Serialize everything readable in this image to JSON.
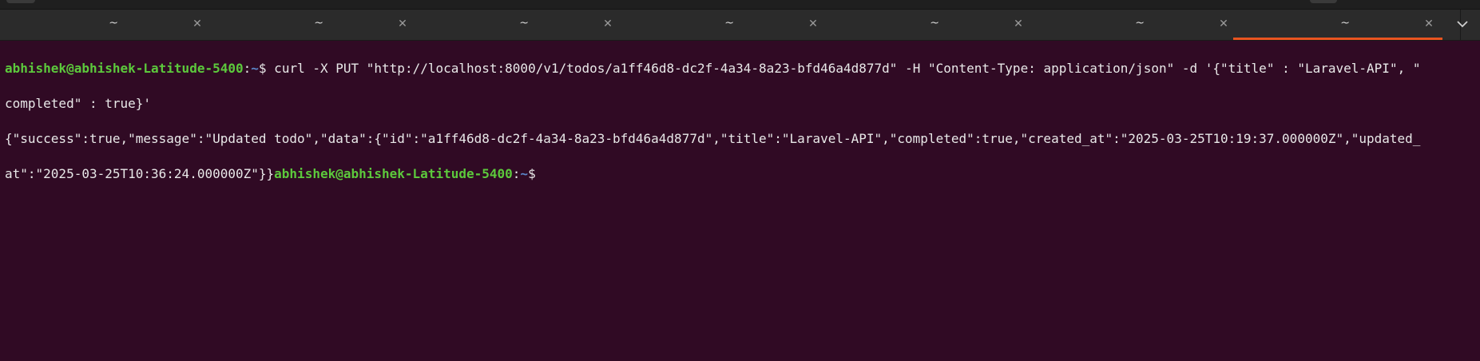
{
  "window": {
    "accent_color": "#e95420",
    "background_color": "#300a24",
    "prompt_user_color": "#5cc93c",
    "prompt_path_color": "#5b86c9"
  },
  "tabs": [
    {
      "title": "~",
      "close_icon": "close-icon"
    },
    {
      "title": "~",
      "close_icon": "close-icon"
    },
    {
      "title": "~",
      "close_icon": "close-icon"
    },
    {
      "title": "~",
      "close_icon": "close-icon"
    },
    {
      "title": "~",
      "close_icon": "close-icon"
    },
    {
      "title": "~",
      "close_icon": "close-icon"
    },
    {
      "title": "~",
      "close_icon": "close-icon",
      "active": true
    }
  ],
  "tab_menu_icon": "chevron-down-icon",
  "terminal": {
    "prompt_user": "abhishek@abhishek-Latitude-5400",
    "prompt_sep": ":",
    "prompt_path": "~",
    "prompt_symbol": "$",
    "command_line1": " curl -X PUT \"http://localhost:8000/v1/todos/a1ff46d8-dc2f-4a34-8a23-bfd46a4d877d\" -H \"Content-Type: application/json\" -d '{\"title\" : \"Laravel-API\", \"",
    "command_line2": "completed\" : true}'",
    "output_line1": "{\"success\":true,\"message\":\"Updated todo\",\"data\":{\"id\":\"a1ff46d8-dc2f-4a34-8a23-bfd46a4d877d\",\"title\":\"Laravel-API\",\"completed\":true,\"created_at\":\"2025-03-25T10:19:37.000000Z\",\"updated_",
    "output_line2": "at\":\"2025-03-25T10:36:24.000000Z\"}}",
    "prompt2_user": "abhishek@abhishek-Latitude-5400",
    "prompt2_sep": ":",
    "prompt2_path": "~",
    "prompt2_symbol": "$ "
  }
}
